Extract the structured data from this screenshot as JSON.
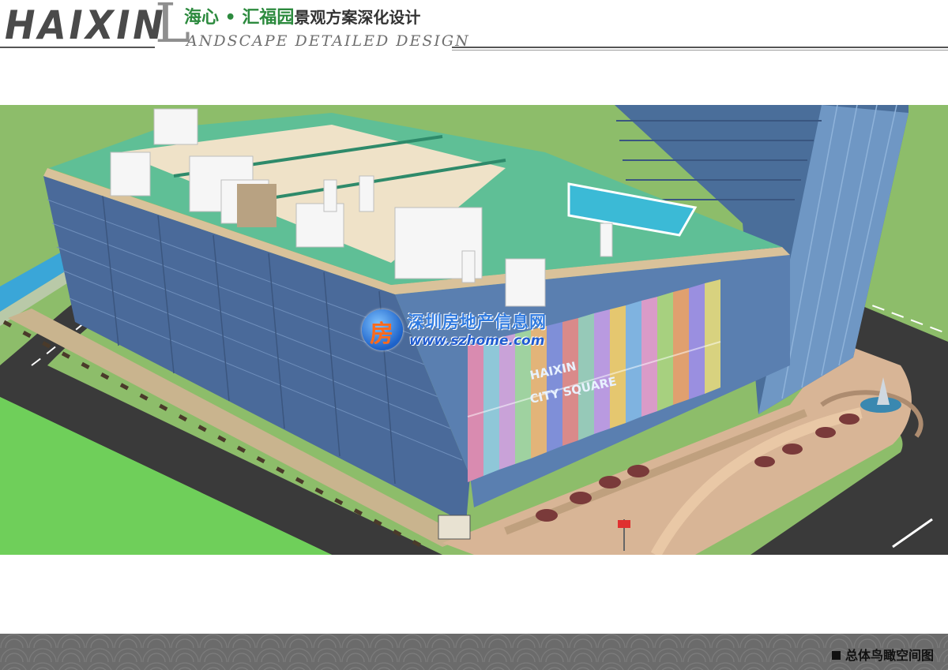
{
  "header": {
    "brand": "HAIXIN",
    "big_letter": "L",
    "title_project": "海心 • 汇福园",
    "title_rest": "景观方案深化设计",
    "subtitle_en": "ANDSCAPE DETAILED DESIGN"
  },
  "render": {
    "facade_text_line1": "HAIXIN",
    "facade_text_line2": "CITY SQUARE"
  },
  "watermark": {
    "logo_mark": "房",
    "site_name": "深圳房地产信息网",
    "url": "www.szhome.com"
  },
  "footer": {
    "caption": "总体鸟瞰空间图"
  },
  "colors": {
    "brand_green": "#2c8a3e",
    "grass": "#8dbd6a",
    "road": "#3a3a3a",
    "glass": "#4a6a9a",
    "roof_green": "#5fbf96"
  }
}
